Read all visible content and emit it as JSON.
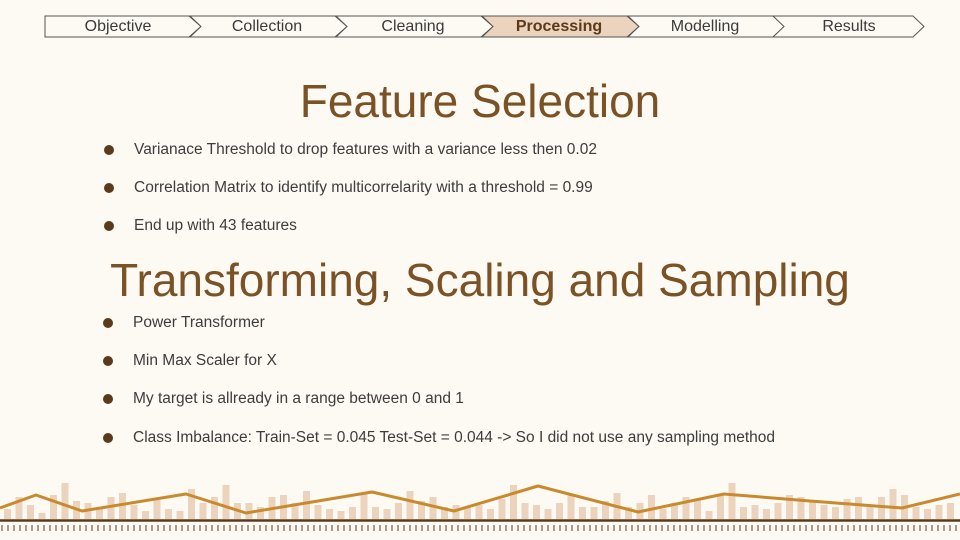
{
  "breadcrumb": {
    "steps": [
      {
        "label": "Objective"
      },
      {
        "label": "Collection"
      },
      {
        "label": "Cleaning"
      },
      {
        "label": "Processing",
        "active": true
      },
      {
        "label": "Modelling"
      },
      {
        "label": "Results"
      }
    ]
  },
  "feature_selection": {
    "title": "Feature Selection",
    "bullets": [
      "Varianace Threshold to drop features with a variance less then 0.02",
      "Correlation Matrix to identify multicorrelarity with a threshold = 0.99",
      "End up with 43 features"
    ]
  },
  "transforming": {
    "title": "Transforming, Scaling and Sampling",
    "bullets": [
      "Power Transformer",
      "Min Max Scaler for X",
      "My target is allready in a range between 0 and 1",
      "Class Imbalance: Train-Set = 0.045 Test-Set = 0.044 -> So I did not use any sampling method"
    ]
  },
  "colors": {
    "accent": "#7b5226",
    "active_step_fill": "#ecd3bd",
    "bar_fill": "#ecd3bd",
    "line_stroke": "#c98a2e",
    "base_line": "#5a3a1a"
  }
}
